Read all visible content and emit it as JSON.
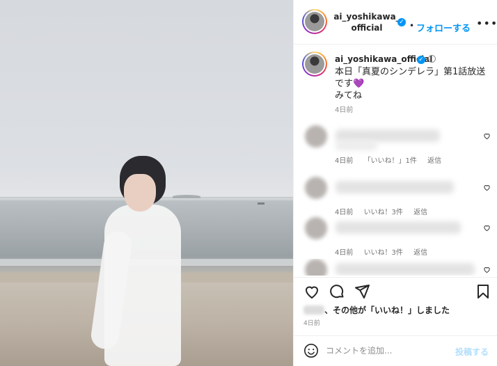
{
  "header": {
    "username": "ai_yoshikawa_official",
    "separator": "•",
    "follow_label": "フォローする",
    "more_label": "•••"
  },
  "caption": {
    "username": "ai_yoshikawa_official",
    "line1": "本日「真夏のシンデレラ」第1話放送です",
    "heart": "💜",
    "line2": "みてね",
    "time": "4日前"
  },
  "comments": [
    {
      "time": "4日前",
      "likes": "「いいね！」1件",
      "reply": "返信"
    },
    {
      "time": "4日前",
      "likes": "いいね！3件",
      "reply": "返信"
    },
    {
      "time": "4日前",
      "likes": "いいね！3件",
      "reply": "返信"
    },
    {
      "time": "",
      "likes": "",
      "reply": ""
    }
  ],
  "likes": {
    "suffix": "、その他が「いいね！」しました",
    "others": "その他",
    "time": "4日前"
  },
  "comment_input": {
    "placeholder": "コメントを追加...",
    "post_label": "投稿する"
  },
  "icons": {
    "verified": "verified-badge-icon",
    "heart": "heart-icon",
    "comment": "comment-icon",
    "share": "share-icon",
    "save": "bookmark-icon",
    "emoji": "emoji-icon",
    "more": "more-icon"
  },
  "colors": {
    "accent": "#0095f6",
    "post_disabled": "#b2dffc",
    "muted": "#8e8e8e"
  }
}
